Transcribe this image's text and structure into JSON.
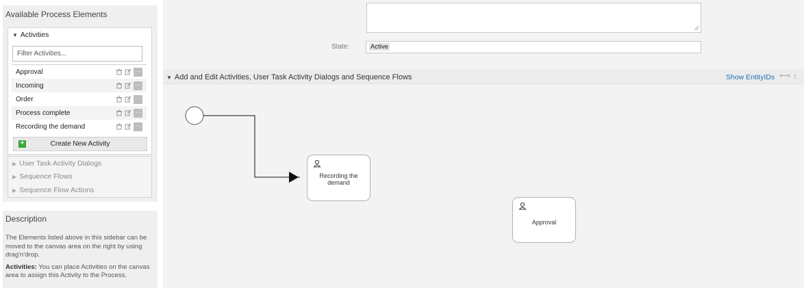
{
  "sidebar": {
    "title": "Available Process Elements",
    "activities_header": "Activities",
    "filter_placeholder": "Filter Activities...",
    "activities": [
      {
        "label": "Approval"
      },
      {
        "label": "Incoming"
      },
      {
        "label": "Order"
      },
      {
        "label": "Process complete"
      },
      {
        "label": "Recording the demand"
      }
    ],
    "create_button": "Create New Activity",
    "collapsed_sections": [
      {
        "label": "User Task Activity Dialogs"
      },
      {
        "label": "Sequence Flows"
      },
      {
        "label": "Sequence Flow Actions"
      }
    ],
    "row_icons": [
      "trash-icon",
      "edit-icon",
      "more-icon"
    ]
  },
  "description": {
    "title": "Description",
    "paragraph": "The Elements listed above in this sidebar can be moved to the canvas area on the right by using drag'n'drop.",
    "activities_bold": "Activities:",
    "activities_text": " You can place Activities on the canvas area to assign this Activity to the Process."
  },
  "form": {
    "state_label": "State:",
    "state_value": "Active"
  },
  "editor": {
    "section_title": "Add and Edit Activities, User Task Activity Dialogs and Sequence Flows",
    "show_entity_ids": "Show EntityIDs",
    "activities": [
      {
        "label": "Recording the demand"
      },
      {
        "label": "Approval"
      }
    ]
  },
  "colors": {
    "link": "#1f6fb5",
    "create_plus": "#3aa63a",
    "canvas_bg": "#f3f3f3"
  }
}
